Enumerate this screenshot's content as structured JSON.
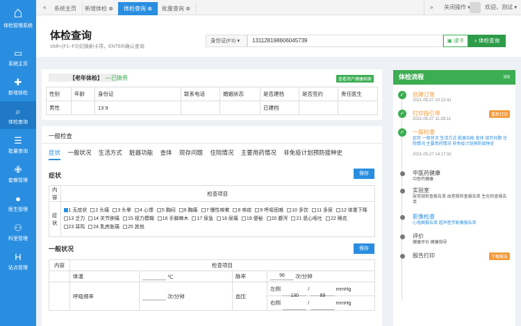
{
  "sidebar": {
    "logo_text": "体检管理系统",
    "items": [
      {
        "label": "系统主页",
        "icon": "monitor-icon"
      },
      {
        "label": "新增体检",
        "icon": "plus-icon"
      },
      {
        "label": "体检查询",
        "icon": "search-icon"
      },
      {
        "label": "批量查询",
        "icon": "database-icon"
      },
      {
        "label": "套餐管理",
        "icon": "medkit-icon"
      },
      {
        "label": "医生管理",
        "icon": "user-icon"
      },
      {
        "label": "科室管理",
        "icon": "users-icon"
      },
      {
        "label": "站点管理",
        "icon": "hospital-icon"
      }
    ]
  },
  "topbar": {
    "tabs": [
      "系统主页",
      "新增体检",
      "体检查询",
      "批量查询"
    ],
    "close_ops": "关闭操作",
    "welcome": "欢迎，测试"
  },
  "header": {
    "title": "体检查询",
    "subtitle": "shift+(F1~F3)切换刷卡项，ENTER确认查询",
    "id_type": "身份证(F3)",
    "id_value": "131128198606045739",
    "read_card": "读卡",
    "query": "体检查询"
  },
  "patient": {
    "name_suffix": "【老年体检】",
    "status": "—已缴费",
    "view_btn": "查看用户健康档案",
    "headers": [
      "性别",
      "年龄",
      "身份证",
      "联系电话",
      "婚姻状态",
      "是否建档",
      "是否签约",
      "责任医生"
    ],
    "row": [
      "男性",
      "",
      "13                    9",
      "",
      "",
      "已建档",
      "",
      ""
    ]
  },
  "exam": {
    "section": "一般检查",
    "tabs": [
      "症状",
      "一般状况",
      "生活方式",
      "脏器功能",
      "查体",
      "现存问题",
      "住院情况",
      "主要用药情况",
      "非免疫计划预防接种史"
    ],
    "symptom_title": "症状",
    "save": "保存",
    "col_content": "内容",
    "col_items": "检查项目",
    "row_label": "症状",
    "symptoms": [
      "1 无症状",
      "2 头痛",
      "3 头晕",
      "4 心悸",
      "5 胸闷",
      "6 胸痛",
      "7 慢性咳嗽",
      "8 咳痰",
      "9 呼吸困难",
      "10 多饮",
      "11 多尿",
      "12 体重下降",
      "13 乏力",
      "14 关节肿痛",
      "15 视力模糊",
      "16 手脚麻木",
      "17 尿急",
      "18 尿痛",
      "19 便秘",
      "20 腹泻",
      "21 恶心呕吐",
      "22 眼花",
      "23 耳鸣",
      "24 乳房胀痛",
      "25 其他"
    ],
    "general_title": "一般状况",
    "temp_label": "体温",
    "temp_unit": "℃",
    "pulse_label": "脉率",
    "pulse_value": "96",
    "pulse_unit": "次/分钟",
    "resp_label": "呼吸频率",
    "resp_unit": "次/分钟",
    "bp_label": "血压",
    "left": "左侧",
    "right": "右侧",
    "bp_sys": "130",
    "bp_slash": "/",
    "bp_dia": "89",
    "bp_unit": "mmHg"
  },
  "flow": {
    "title": "体检流程",
    "count": "3/8",
    "steps": [
      {
        "name": "创建订单",
        "time": "2021-05-27 10:12:41",
        "done": true
      },
      {
        "name": "打印指引单",
        "time": "2021-05-27 11:28:11",
        "done": true,
        "badge": "重新打印"
      },
      {
        "name": "一般检查",
        "time": "2021-05-27 14:17:32",
        "done": true,
        "detail": "症状 一般状况 生活方式 脏器功能 查体 现存问题 住院情况 主要用药情况 非免疫计划预防接种史"
      },
      {
        "name": "中医药健康",
        "detail": "中医药健康"
      },
      {
        "name": "实验室",
        "detail": "尿常规检查报告单 血常规检查报告单 生化检查报告单"
      },
      {
        "name": "影像检查",
        "detail": "心电图报告单 超声医学影像报告单"
      },
      {
        "name": "评价",
        "detail": "健康评价 健康指导"
      },
      {
        "name": "报告打印",
        "badge": "下载报告"
      }
    ]
  },
  "colors": {
    "primary": "#2a8ee0",
    "success": "#3cad52",
    "warning": "#f39a38"
  }
}
